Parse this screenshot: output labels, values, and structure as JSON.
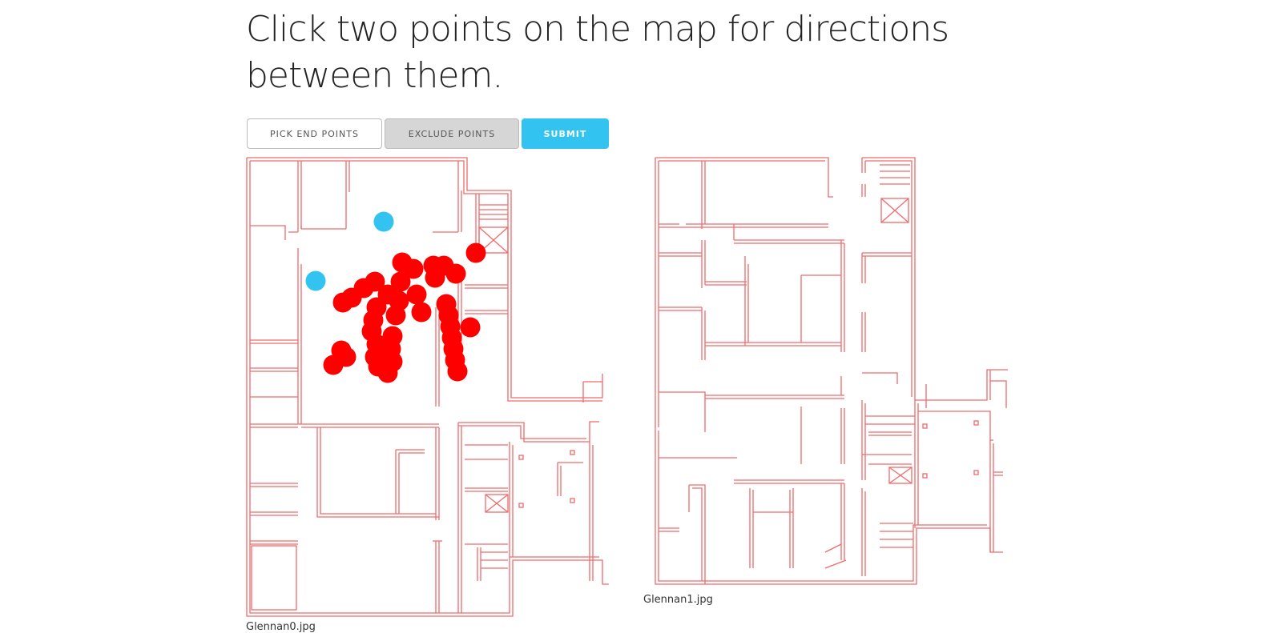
{
  "page": {
    "title": "Click two points on the map for directions between them."
  },
  "toolbar": {
    "pick_label": "Pick End Points",
    "exclude_label": "Exclude Points",
    "submit_label": "Submit"
  },
  "maps": [
    {
      "caption": "Glennan0.jpg"
    },
    {
      "caption": "Glennan1.jpg"
    }
  ],
  "colors": {
    "wall": "#f26a6a",
    "endpoint": "#33c3f0",
    "excluded": "#ff0000",
    "submit": "#33c3f0"
  },
  "markers": {
    "endpoints_count": 2,
    "excluded_points_count": 48
  }
}
